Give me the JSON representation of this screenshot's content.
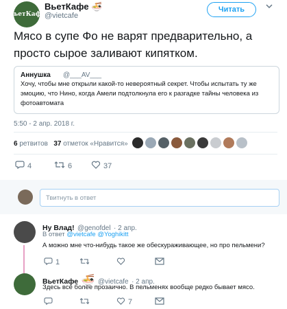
{
  "tweet": {
    "author_name": "ВьетКафе",
    "author_emoji": "🍜",
    "author_handle": "@vietcafe",
    "avatar_text": "ВьетКафе",
    "follow_label": "Читать",
    "text": "Мясо в супе Фо не варят предварительно, а просто сырое заливают кипятком.",
    "timestamp": "5:50 - 2 апр. 2018 г.",
    "retweets_count": "6",
    "retweets_label": "ретвитов",
    "likes_count": "37",
    "likes_label": "отметок «Нравится»",
    "actions": {
      "replies": "4",
      "retweets": "6",
      "likes": "37"
    }
  },
  "quote": {
    "name": "Аннушка",
    "handle": "@___AV___",
    "text": "Хочу, чтобы мне открыли какой-то невероятный секрет. Чтобы испытать ту же эмоцию, что Нино, когда Амели подтолкнула его к разгадке тайны  человека из фотоавтомата"
  },
  "reply_box": {
    "placeholder": "Твитнуть в ответ"
  },
  "comments": [
    {
      "name": "Ну Влад!",
      "handle": "@genofdel",
      "time": "· 2 апр.",
      "reply_prefix": "В ответ",
      "reply_to": "@vietcafe @Yoghikitt",
      "text": "А можно мне что-нибудь такое же обескураживающее, но про пельмени?",
      "actions": {
        "replies": "1",
        "retweets": "",
        "likes": ""
      }
    },
    {
      "name": "ВьетКафе",
      "emoji": "🍜",
      "handle": "@vietcafe",
      "time": "· 2 апр.",
      "text": "Здесь всё более прозаично. В пельменях вообще редко бывает мясо.",
      "actions": {
        "replies": "",
        "retweets": "",
        "likes": "7"
      }
    }
  ],
  "colors": {
    "accent": "#1da1f2",
    "thread": "#e7a0c4",
    "muted": "#657786"
  }
}
